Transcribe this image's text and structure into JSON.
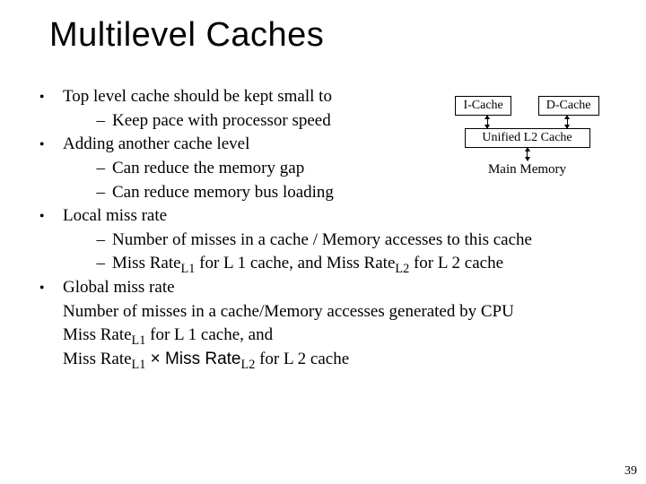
{
  "title": "Multilevel Caches",
  "bullets": {
    "b1": "Top level cache should be kept small to",
    "b1_s1": "Keep pace with processor speed",
    "b2": "Adding another cache level",
    "b2_s1": "Can reduce the memory gap",
    "b2_s2": "Can reduce memory bus loading",
    "b3": "Local miss rate",
    "b3_s1": "Number of misses in a cache / Memory accesses to this cache",
    "b3_s2_pre": "Miss Rate",
    "b3_s2_sub1": "L1",
    "b3_s2_mid": " for L 1 cache, and Miss Rate",
    "b3_s2_sub2": "L2",
    "b3_s2_post": " for L 2 cache",
    "b4": "Global miss rate",
    "b4_l1": "Number of misses in a cache/Memory accesses generated by CPU",
    "b4_l2_pre": "Miss Rate",
    "b4_l2_sub": "L1",
    "b4_l2_post": " for L 1 cache, and",
    "b4_l3_pre": "Miss Rate",
    "b4_l3_sub1": "L1",
    "b4_l3_mid": " × Miss Rate",
    "b4_l3_sub2": "L2",
    "b4_l3_post": " for L 2 cache"
  },
  "diagram": {
    "icache": "I-Cache",
    "dcache": "D-Cache",
    "l2": "Unified L2 Cache",
    "main": "Main Memory"
  },
  "slide_number": "39"
}
